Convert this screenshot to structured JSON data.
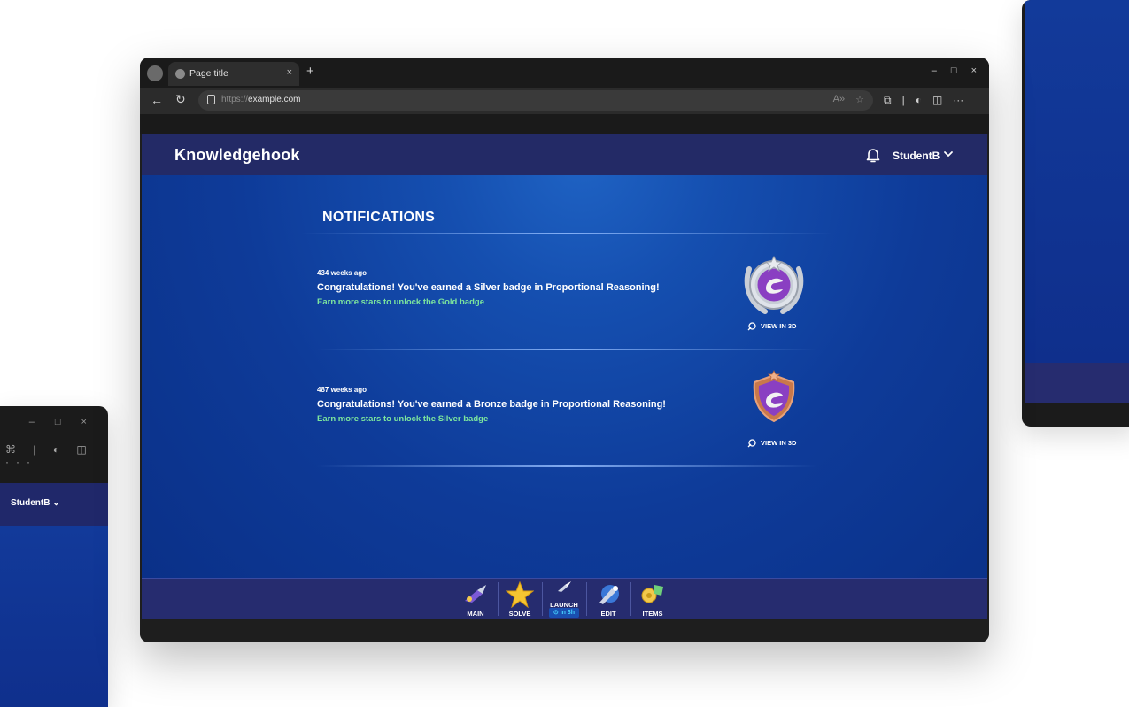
{
  "browser": {
    "tab_title": "Page title",
    "tab_close": "×",
    "new_tab": "+",
    "url_scheme": "https://",
    "url_host": "example.com",
    "window_controls": [
      "–",
      "□",
      "×"
    ]
  },
  "app": {
    "brand": "Knowledgehook",
    "username": "StudentB"
  },
  "notifications": {
    "title": "NOTIFICATIONS",
    "items": [
      {
        "time": "434 weeks ago",
        "message": "Congratulations! You've earned a Silver badge in Proportional Reasoning!",
        "sub": "Earn more stars to unlock the Gold badge",
        "badge": "silver-badge",
        "view3d_label": "VIEW IN 3D"
      },
      {
        "time": "487 weeks ago",
        "message": "Congratulations! You've earned a Bronze badge in Proportional Reasoning!",
        "sub": "Earn more stars to unlock the Silver badge",
        "badge": "bronze-badge",
        "view3d_label": "VIEW IN 3D"
      }
    ]
  },
  "bottom_nav": {
    "main": "MAIN",
    "solve": "SOLVE",
    "launch": "LAUNCH",
    "launch_timer": "⊙ in 3h",
    "edit": "EDIT",
    "items": "ITEMS"
  },
  "background": {
    "left_username": "StudentB"
  },
  "colors": {
    "header": "#232a66",
    "page_bg": "#0e3b99",
    "accent_green": "#7de69d",
    "timer_cyan": "#46d2ff"
  }
}
